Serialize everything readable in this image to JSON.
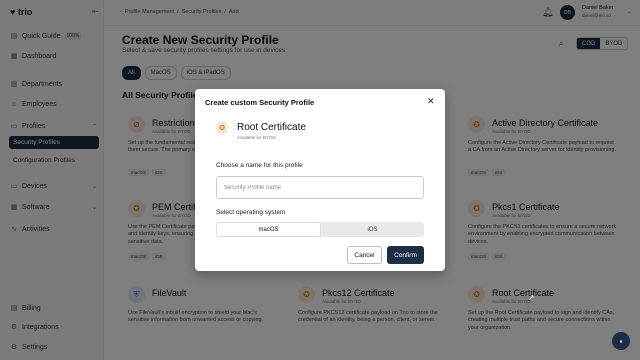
{
  "app": {
    "logo": "trio"
  },
  "sidebar": {
    "quick_guide": {
      "label": "Quick Guide",
      "badge": "100%"
    },
    "items": [
      {
        "key": "dashboard",
        "label": "Dashboard",
        "icon": "grid-icon"
      },
      {
        "key": "departments",
        "label": "Departments",
        "icon": "building-icon"
      },
      {
        "key": "employees",
        "label": "Employees",
        "icon": "users-icon"
      },
      {
        "key": "profiles",
        "label": "Profiles",
        "icon": "folder-icon"
      },
      {
        "key": "devices",
        "label": "Devices",
        "icon": "monitor-icon"
      },
      {
        "key": "software",
        "label": "Software",
        "icon": "grid-icon"
      },
      {
        "key": "activities",
        "label": "Activities",
        "icon": "activity-icon"
      }
    ],
    "subitems": [
      {
        "label": "Security Profiles",
        "active": true
      },
      {
        "label": "Configuration Profiles",
        "active": false
      }
    ],
    "bottom": [
      {
        "label": "Billing"
      },
      {
        "label": "Integrations"
      },
      {
        "label": "Settings"
      }
    ]
  },
  "header": {
    "breadcrumb": [
      "Profile Management",
      "Security Profiles",
      "Add"
    ],
    "user": {
      "name": "Daniel Baker",
      "email": "daniel@trio.so",
      "initials": "DB"
    }
  },
  "main": {
    "title": "Create New Security Profile",
    "subtitle": "Select & save security profiles settings for use in devices",
    "ownership_toggle": [
      "COD",
      "BYOD"
    ],
    "ownership_selected": "COD",
    "filters": [
      "All",
      "MacOS",
      "iOS & iPadOS"
    ],
    "filter_selected": "All",
    "section_title": "All Security Profiles",
    "cards": [
      {
        "title": "Restrictions",
        "tag": "Available for BYOD",
        "desc": "Set up the fundamental restrictions on your endpoints to keep them secure. The primary steps against attacks.",
        "os": [
          "macOS",
          "iOS"
        ],
        "icon": "restriction-icon",
        "color": "#d94b3b"
      },
      {
        "title": "Active Directory Certificate",
        "tag": "Available for BYOD",
        "desc": "Configure the Active Directory Certificate payload to request a CA from an Active Directory server for identity provisioning.",
        "os": [
          "macOS",
          "iOS"
        ],
        "icon": "certificate-icon",
        "color": "#d97a1a"
      },
      {
        "title": "PEM Certificate",
        "tag": "Available for BYOD",
        "desc": "Use the PEM Certificate payload to install PEM certificates and identity keys, ensuring secure access control access to sensitive data.",
        "os": [
          "macOS",
          "iOS"
        ],
        "icon": "certificate-icon",
        "color": "#d97a1a"
      },
      {
        "title": "Pkcs1 Certificate",
        "tag": "Available for BYOD",
        "desc": "Configure the PKCS1 certificates to ensure a secure network environment by enabling encrypted communication between devices.",
        "os": [
          "macOS",
          "iOS"
        ],
        "icon": "certificate-icon",
        "color": "#d97a1a"
      },
      {
        "title": "FileVault",
        "tag": "",
        "desc": "Use FileVault's inbuilt encryption to shield your Mac's sensitive information from unwanted access or copying.",
        "os": [
          "macOS"
        ],
        "icon": "shield-icon",
        "color": "#2f6fd1"
      },
      {
        "title": "Pkcs12 Certificate",
        "tag": "Available for BYOD",
        "desc": "Configure PKCS12 certificate payload on Trio to store the credential of an identity, being a person, client, or server.",
        "os": [
          "macOS",
          "iOS"
        ],
        "icon": "certificate-icon",
        "color": "#d97a1a"
      },
      {
        "title": "Root Certificate",
        "tag": "Available for BYOD",
        "desc": "Set up the Root Certificate payload to sign and identify CAs, creating multiple trust paths and secure connections within your organization.",
        "os": [
          "macOS",
          "iOS"
        ],
        "icon": "certificate-icon",
        "color": "#d97a1a"
      }
    ]
  },
  "modal": {
    "title": "Create custom Security Profile",
    "profile_name": "Root Certificate",
    "profile_tag": "Available for BYOD",
    "name_label": "Choose a name for this profile",
    "name_placeholder": "Security Profile name",
    "name_value": "",
    "os_label": "Select operating system",
    "os_options": [
      "macOS",
      "iOS"
    ],
    "os_selected": "macOS",
    "cancel_label": "Cancel",
    "confirm_label": "Confirm"
  }
}
